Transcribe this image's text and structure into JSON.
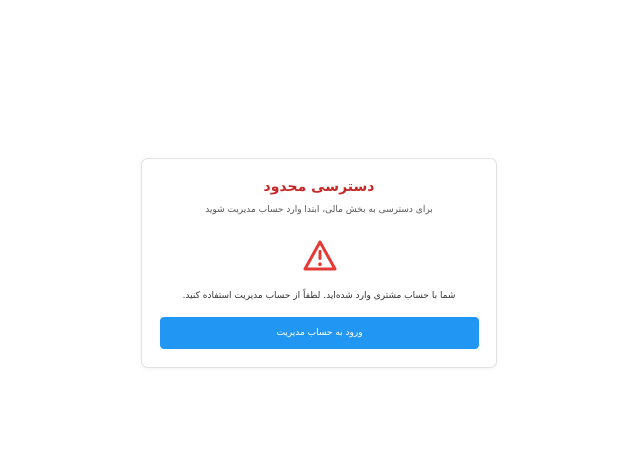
{
  "access_card": {
    "title": "دسترسی محدود",
    "subtitle": "برای دسترسی به بخش مالی، ابتدا وارد حساب مدیریت شوید",
    "icon": "warning-triangle-icon",
    "message": "شما با حساب مشتری وارد شده‌اید. لطفاً از حساب مدیریت استفاده کنید.",
    "login_button_label": "ورود به حساب مدیریت"
  },
  "colors": {
    "title": "#c62828",
    "warning_icon": "#e53935",
    "button": "#2196f3",
    "card_border": "#e2e2e2"
  }
}
